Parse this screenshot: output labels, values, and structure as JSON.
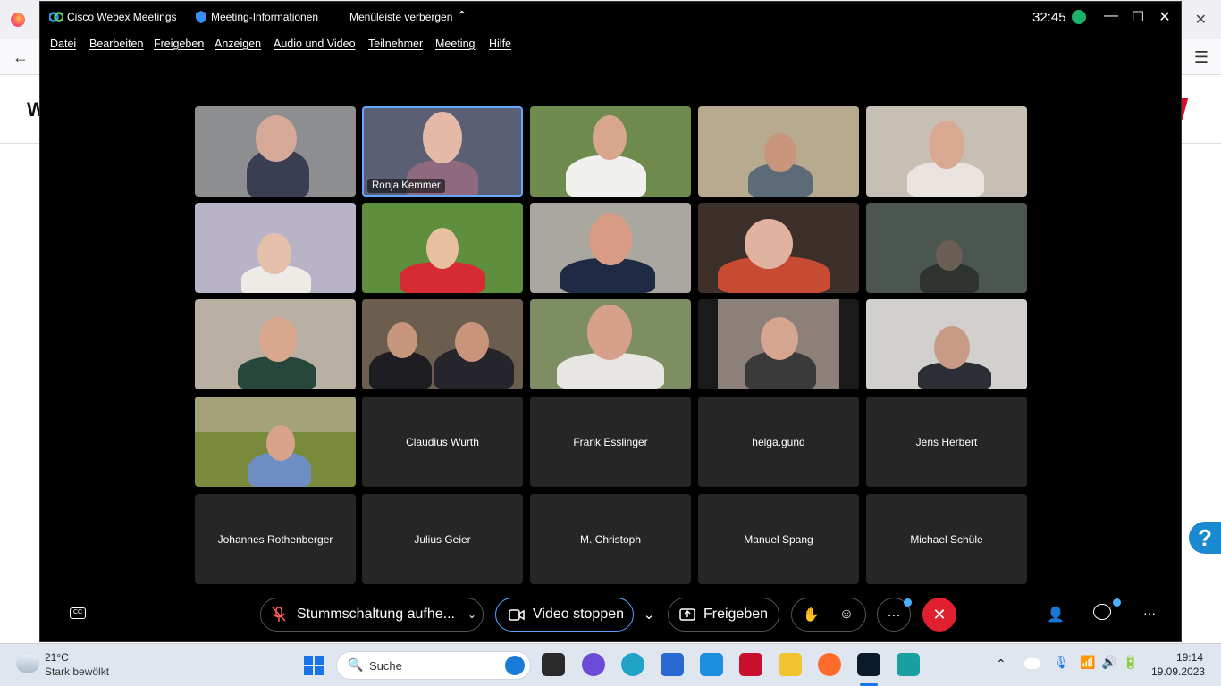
{
  "webex": {
    "app_title": "Cisco Webex Meetings",
    "meeting_info": "Meeting-Informationen",
    "hide_menubar": "Menüleiste verbergen",
    "timer": "32:45",
    "menu": [
      "Datei",
      "Bearbeiten",
      "Freigeben",
      "Anzeigen",
      "Audio und Video",
      "Teilnehmer",
      "Meeting",
      "Hilfe"
    ],
    "active_speaker_label": "Ronja Kemmer",
    "name_tiles": [
      "Claudius Wurth",
      "Frank Esslinger",
      "helga.gund",
      "Jens Herbert",
      "Johannes Rothenberger",
      "Julius Geier",
      "M. Christoph",
      "Manuel Spang",
      "Michael Schüle"
    ],
    "toolbar": {
      "unmute_label": "Stummschaltung aufhe...",
      "video_label": "Video stoppen",
      "share_label": "Freigeben"
    },
    "colors": {
      "end_call": "#e0202e",
      "active_border": "#63a7ff",
      "tile_bg": "#262626"
    }
  },
  "taskbar": {
    "weather_temp": "21°C",
    "weather_desc": "Stark bewölkt",
    "search_placeholder": "Suche",
    "time": "19:14",
    "date": "19.09.2023"
  }
}
